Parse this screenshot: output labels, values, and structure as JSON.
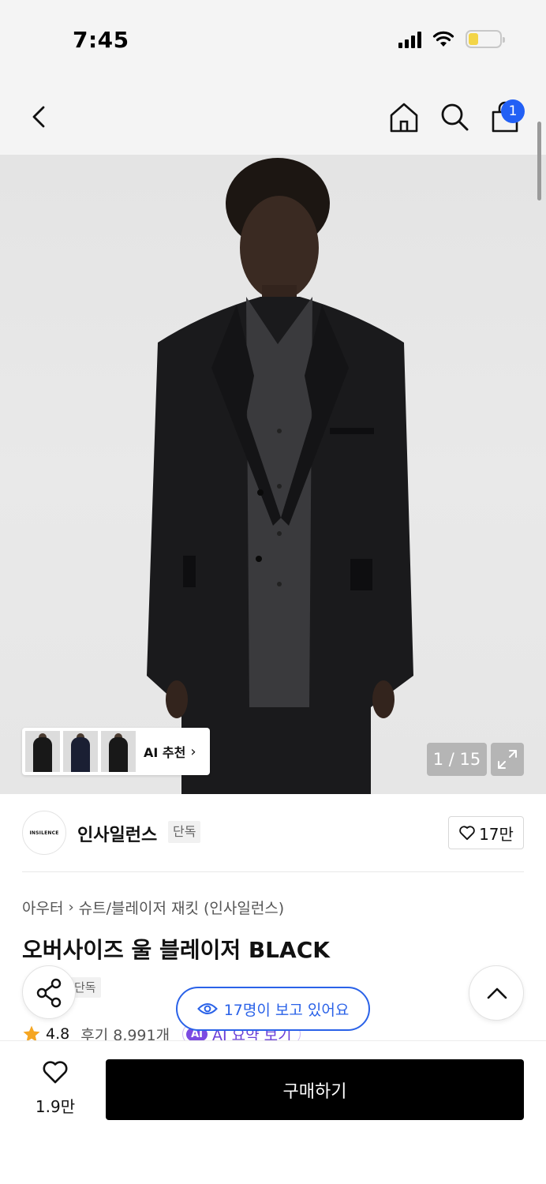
{
  "status_bar": {
    "time": "7:45"
  },
  "nav": {
    "back_icon": "chevron-left-icon",
    "home_icon": "home-icon",
    "search_icon": "search-icon",
    "cart_icon": "shopping-bag-icon",
    "cart_count": "1"
  },
  "gallery": {
    "ai_recommend_label": "AI 추천",
    "page_indicator": "1 / 15"
  },
  "brand": {
    "logo_text": "INSILENCE",
    "name": "인사일런스",
    "tag": "단독",
    "like_count": "17만"
  },
  "breadcrumb": {
    "category": "아우터",
    "subcategory": "슈트/블레이저 재킷 (인사일런스)"
  },
  "product": {
    "title": "오버사이즈 울 블레이저 BLACK",
    "exclusive_tag": "단독",
    "rating": "4.8",
    "reviews": "후기 8,991개",
    "ai_summary_badge": "AI",
    "ai_summary_label": "AI 요약 보기"
  },
  "viewers": {
    "text": "17명이 보고 있어요"
  },
  "bottom_bar": {
    "like_count": "1.9만",
    "buy_label": "구매하기"
  },
  "colors": {
    "accent_blue": "#2a62e8",
    "badge_blue": "#2260f5",
    "ai_purple": "#7b4ae2",
    "star_orange": "#f5a623",
    "buy_black": "#000000"
  }
}
